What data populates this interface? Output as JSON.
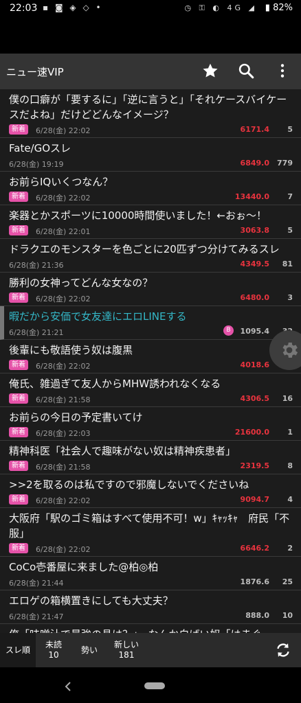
{
  "status": {
    "time": "22:03",
    "battery": "82%",
    "network": "4G"
  },
  "appbar": {
    "title": "ニュー速VIP"
  },
  "labels": {
    "new_badge": "新着"
  },
  "threads": [
    {
      "title": "僕の口癖が「要するに」「逆に言うと」「それケースバイケースだよね」だけどどんなイメージ？",
      "date": "6/28(金) 22:02",
      "ikioi": "6171.4",
      "count": "5",
      "is_new": true
    },
    {
      "title": "Fate/GOスレ",
      "date": "6/28(金) 19:19",
      "ikioi": "6849.0",
      "count": "779",
      "is_new": false
    },
    {
      "title": "お前らIQいくつなん？",
      "date": "6/28(金) 22:02",
      "ikioi": "13440.0",
      "count": "7",
      "is_new": true
    },
    {
      "title": "楽器とかスポーツに10000時間使いました！←おぉ～！",
      "date": "6/28(金) 22:01",
      "ikioi": "3063.8",
      "count": "5",
      "is_new": true
    },
    {
      "title": "ドラクエのモンスターを色ごとに20匹ずつ分けてみるスレ",
      "date": "6/28(金) 21:36",
      "ikioi": "4349.5",
      "count": "81",
      "is_new": false
    },
    {
      "title": "勝利の女神ってどんな女なの？",
      "date": "6/28(金) 22:02",
      "ikioi": "6480.0",
      "count": "3",
      "is_new": true
    },
    {
      "title": "暇だから安価で女友達にエロLINEする",
      "date": "6/28(金) 21:21",
      "ikioi": "1095.4",
      "count": "32",
      "is_new": false,
      "selected": true,
      "mark": "B"
    },
    {
      "title": "後輩にも敬語使う奴は腹黒",
      "date": "6/28(金) 22:02",
      "ikioi": "4018.6",
      "count": "2",
      "is_new": true
    },
    {
      "title": "俺氏、雑過ぎて友人からMHW誘われなくなる",
      "date": "6/28(金) 21:58",
      "ikioi": "4306.5",
      "count": "16",
      "is_new": true
    },
    {
      "title": "お前らの今日の予定書いてけ",
      "date": "6/28(金) 22:03",
      "ikioi": "21600.0",
      "count": "1",
      "is_new": true
    },
    {
      "title": "精神科医「社会人で趣味がない奴は精神疾患者」",
      "date": "6/28(金) 21:58",
      "ikioi": "2319.5",
      "count": "8",
      "is_new": true
    },
    {
      "title": ">>2を取るのは私ですので邪魔しないでくださいね",
      "date": "6/28(金) 22:02",
      "ikioi": "9094.7",
      "count": "4",
      "is_new": true
    },
    {
      "title": "大阪府「駅のゴミ箱はすべて使用不可！w」ｷｬｯｷｬ　府民「不服」",
      "date": "6/28(金) 22:02",
      "ikioi": "6646.2",
      "count": "2",
      "is_new": true
    },
    {
      "title": "CoCo壱番屋に来ました@柏◎柏",
      "date": "6/28(金) 21:44",
      "ikioi": "1876.6",
      "count": "25",
      "is_new": false
    },
    {
      "title": "エロゲの箱横置きにしても大丈夫？",
      "date": "6/28(金) 21:47",
      "ikioi": "888.0",
      "count": "10",
      "is_new": false
    },
    {
      "title": "俺「味噌汁で最強の具は？」　なんか白ばい奴「はまぐ",
      "date": "",
      "ikioi": "",
      "count": "",
      "is_new": false
    }
  ],
  "bottom": {
    "sort_label": "スレ順",
    "unread_label": "未読",
    "unread_count": "10",
    "ikioi_label": "勢い",
    "new_label": "新しい",
    "new_count": "181"
  }
}
